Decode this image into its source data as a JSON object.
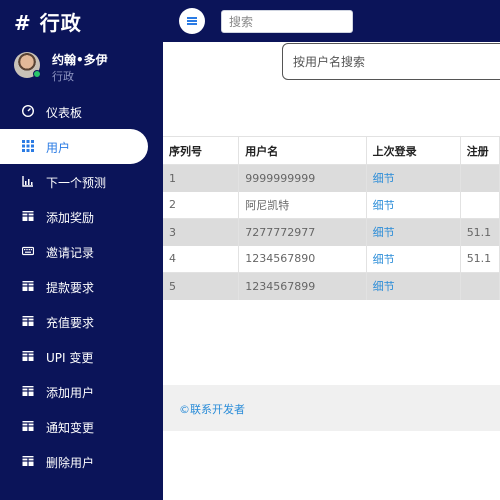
{
  "brand": "# 行政",
  "search": {
    "placeholder": "搜索"
  },
  "profile": {
    "name": "约翰•多伊",
    "role": "行政"
  },
  "nav": [
    {
      "label": "仪表板",
      "icon": "dashboard-icon"
    },
    {
      "label": "用户",
      "icon": "users-icon",
      "active": true
    },
    {
      "label": "下一个预测",
      "icon": "chart-icon"
    },
    {
      "label": "添加奖励",
      "icon": "table-icon"
    },
    {
      "label": "邀请记录",
      "icon": "keyboard-icon"
    },
    {
      "label": "提款要求",
      "icon": "table-icon"
    },
    {
      "label": "充值要求",
      "icon": "table-icon"
    },
    {
      "label": "UPI 变更",
      "icon": "table-icon"
    },
    {
      "label": "添加用户",
      "icon": "table-icon"
    },
    {
      "label": "通知变更",
      "icon": "table-icon"
    },
    {
      "label": "删除用户",
      "icon": "table-icon"
    }
  ],
  "user_search": {
    "placeholder": "按用户名搜索"
  },
  "table": {
    "headers": [
      "序列号",
      "用户名",
      "上次登录",
      "注册"
    ],
    "rows": [
      {
        "serial": "1",
        "username": "9999999999",
        "last_login": "细节",
        "reg": ""
      },
      {
        "serial": "2",
        "username": "阿尼凯特",
        "last_login": "细节",
        "reg": ""
      },
      {
        "serial": "3",
        "username": "7277772977",
        "last_login": "细节",
        "reg": "51.1"
      },
      {
        "serial": "4",
        "username": "1234567890",
        "last_login": "细节",
        "reg": "51.1"
      },
      {
        "serial": "5",
        "username": "1234567899",
        "last_login": "细节",
        "reg": ""
      }
    ]
  },
  "footer": {
    "text": "©联系开发者"
  },
  "colors": {
    "navy": "#0b1459",
    "accent": "#2a7be4",
    "link": "#2a8cd8",
    "online": "#27c46b"
  }
}
